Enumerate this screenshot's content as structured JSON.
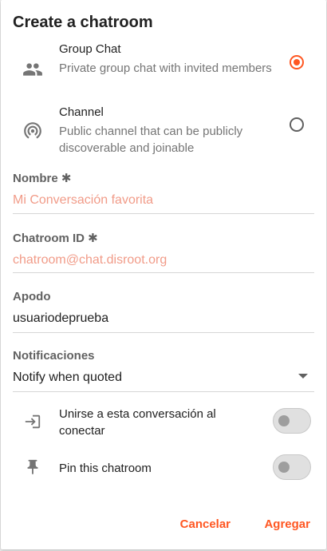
{
  "dialog": {
    "title": "Create a chatroom"
  },
  "room_types": [
    {
      "label": "Group Chat",
      "description": "Private group chat with invited members",
      "selected": true,
      "icon": "group-icon"
    },
    {
      "label": "Channel",
      "description": "Public channel that can be publicly discoverable and joinable",
      "selected": false,
      "icon": "channel-icon"
    }
  ],
  "fields": {
    "name": {
      "label": "Nombre ✱",
      "placeholder": "Mi Conversación favorita"
    },
    "chatroom_id": {
      "label": "Chatroom ID ✱",
      "placeholder": "chatroom@chat.disroot.org"
    },
    "nickname": {
      "label": "Apodo",
      "value": "usuariodeprueba"
    },
    "notifications": {
      "label": "Notificaciones",
      "value": "Notify when quoted"
    }
  },
  "toggles": [
    {
      "label": "Unirse a esta conversación al conectar",
      "icon": "login-icon",
      "on": false
    },
    {
      "label": "Pin this chatroom",
      "icon": "pin-icon",
      "on": false
    }
  ],
  "actions": {
    "cancel": "Cancelar",
    "add": "Agregar"
  },
  "colors": {
    "accent": "#ff5722",
    "placeholder": "#f19b88"
  }
}
